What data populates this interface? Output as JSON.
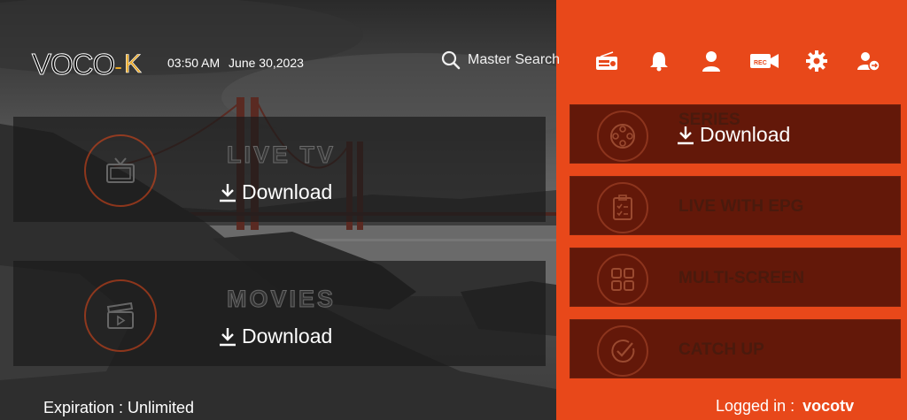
{
  "header": {
    "logo_text": "VOCO",
    "logo_k": "K",
    "time": "03:50 AM",
    "date": "June 30,2023",
    "search_label": "Master Search",
    "icons": [
      "radio-icon",
      "bell-icon",
      "user-icon",
      "rec-camera-icon",
      "gear-icon",
      "switch-user-icon"
    ]
  },
  "left_tiles": [
    {
      "title": "LIVE TV",
      "download_label": "Download",
      "icon": "tv-icon"
    },
    {
      "title": "MOVIES",
      "download_label": "Download",
      "icon": "clapperboard-icon"
    }
  ],
  "right_tiles": [
    {
      "title": "SERIES",
      "download_label": "Download",
      "icon": "film-reel-icon"
    },
    {
      "title": "LIVE WITH EPG",
      "icon": "clipboard-icon"
    },
    {
      "title": "MULTI-SCREEN",
      "icon": "grid-icon"
    },
    {
      "title": "CATCH UP",
      "icon": "check-circle-icon"
    }
  ],
  "footer": {
    "expiration": "Expiration : Unlimited",
    "logged_in_label": "Logged in :",
    "username": "vocotv"
  },
  "colors": {
    "accent": "#e8481a",
    "logo_gold": "#e9a826"
  }
}
